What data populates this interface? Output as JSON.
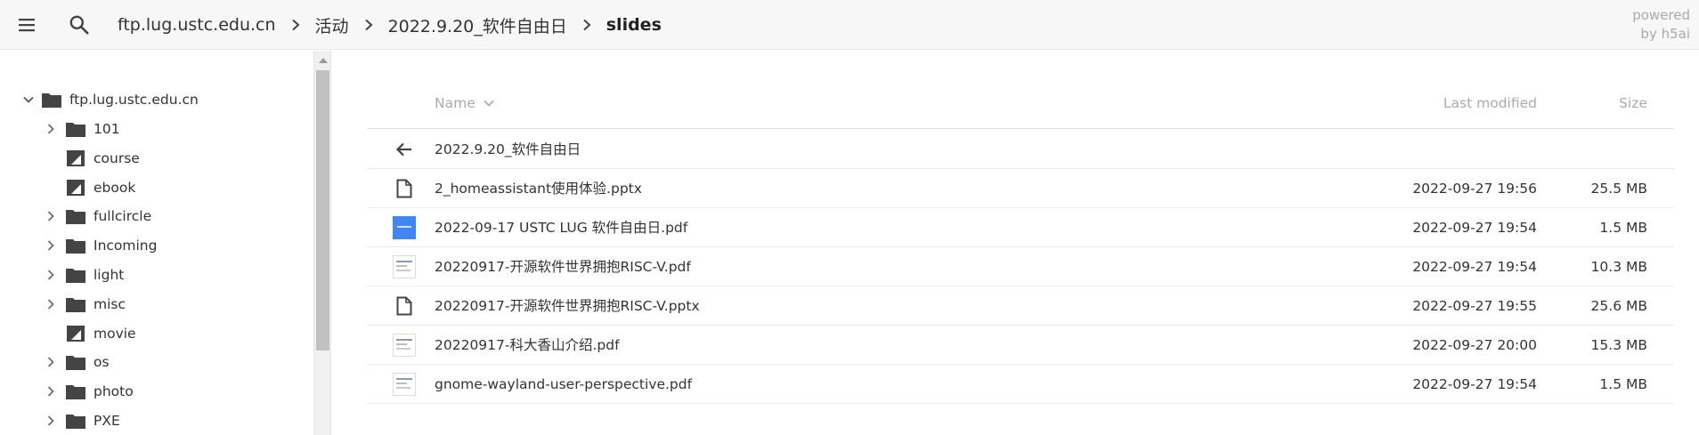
{
  "topbar": {
    "menu_icon": "hamburger-menu-icon",
    "search_icon": "search-icon",
    "breadcrumbs": [
      {
        "label": "ftp.lug.ustc.edu.cn"
      },
      {
        "label": "活动"
      },
      {
        "label": "2022.9.20_软件自由日"
      },
      {
        "label": "slides"
      }
    ],
    "powered_line1": "powered",
    "powered_line2": "by h5ai"
  },
  "sidebar": {
    "root": {
      "label": "ftp.lug.ustc.edu.cn",
      "expanded": true
    },
    "items": [
      {
        "label": "101",
        "type": "folder",
        "expandable": true
      },
      {
        "label": "course",
        "type": "folder-link",
        "expandable": false
      },
      {
        "label": "ebook",
        "type": "folder-link",
        "expandable": false
      },
      {
        "label": "fullcircle",
        "type": "folder",
        "expandable": true
      },
      {
        "label": "Incoming",
        "type": "folder",
        "expandable": true
      },
      {
        "label": "light",
        "type": "folder",
        "expandable": true
      },
      {
        "label": "misc",
        "type": "folder",
        "expandable": true
      },
      {
        "label": "movie",
        "type": "folder-link",
        "expandable": false
      },
      {
        "label": "os",
        "type": "folder",
        "expandable": true
      },
      {
        "label": "photo",
        "type": "folder",
        "expandable": true
      },
      {
        "label": "PXE",
        "type": "folder",
        "expandable": true
      }
    ]
  },
  "list": {
    "header": {
      "name": "Name",
      "modified": "Last modified",
      "size": "Size"
    },
    "parent": {
      "label": "2022.9.20_软件自由日",
      "icon": "back-arrow-icon"
    },
    "rows": [
      {
        "name": "2_homeassistant使用体验.pptx",
        "modified": "2022-09-27 19:56",
        "size": "25.5 MB",
        "icon": "file-icon"
      },
      {
        "name": "2022-09-17 USTC LUG 软件自由日.pdf",
        "modified": "2022-09-27 19:54",
        "size": "1.5 MB",
        "icon": "pdf-thumbnail-blue-icon"
      },
      {
        "name": "20220917-开源软件世界拥抱RISC-V.pdf",
        "modified": "2022-09-27 19:54",
        "size": "10.3 MB",
        "icon": "pdf-thumbnail-icon"
      },
      {
        "name": "20220917-开源软件世界拥抱RISC-V.pptx",
        "modified": "2022-09-27 19:55",
        "size": "25.6 MB",
        "icon": "file-icon"
      },
      {
        "name": "20220917-科大香山介绍.pdf",
        "modified": "2022-09-27 20:00",
        "size": "15.3 MB",
        "icon": "pdf-thumbnail-icon"
      },
      {
        "name": "gnome-wayland-user-perspective.pdf",
        "modified": "2022-09-27 19:54",
        "size": "1.5 MB",
        "icon": "pdf-thumbnail-icon"
      }
    ]
  },
  "colors": {
    "accent": "#4285f4",
    "icon": "#444444",
    "muted": "#aaaaaa"
  }
}
